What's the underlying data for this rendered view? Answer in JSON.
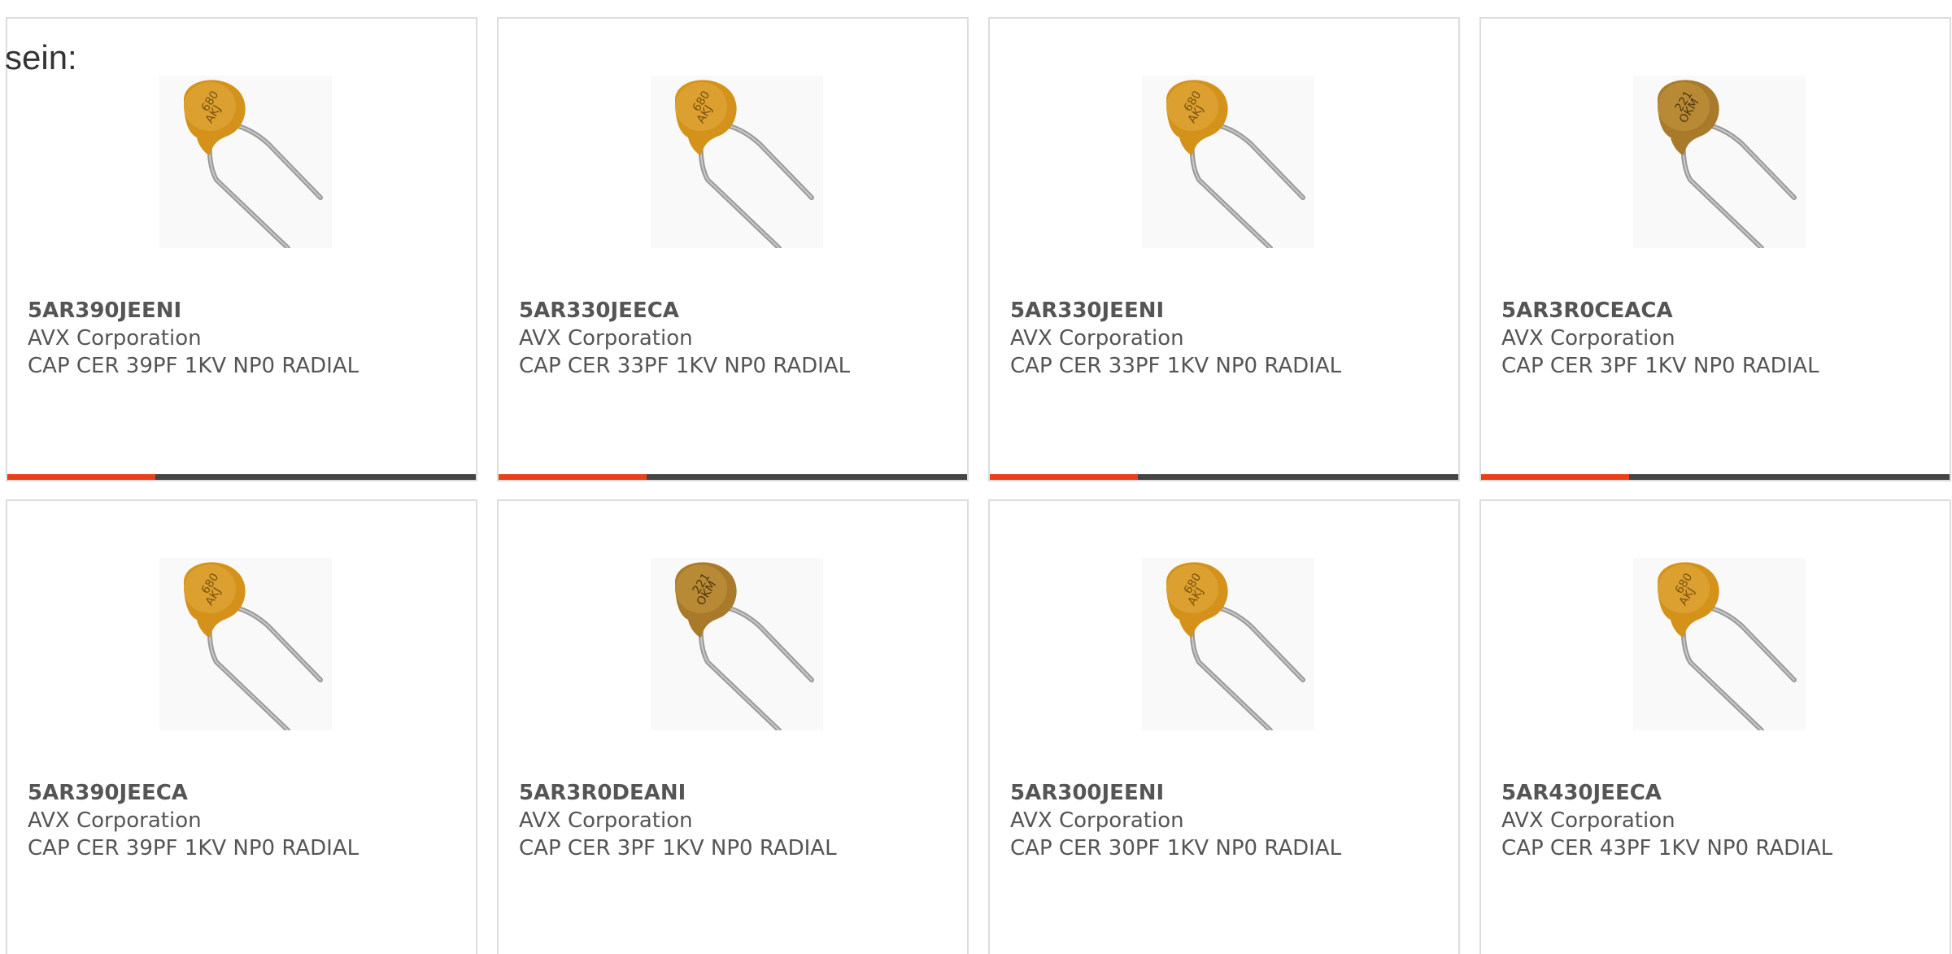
{
  "intro_text": "sein:",
  "colors": {
    "accent": "#e8401c",
    "bar": "#444444",
    "card_border": "#dddddd",
    "text": "#555555",
    "capacitor_body_a": "#d4921a",
    "capacitor_body_b": "#a87a2a"
  },
  "products": [
    {
      "part_number": "5AR390JEENI",
      "manufacturer": "AVX Corporation",
      "description": "CAP CER 39PF 1KV NP0 RADIAL",
      "image_icon": "ceramic-capacitor-icon"
    },
    {
      "part_number": "5AR330JEECA",
      "manufacturer": "AVX Corporation",
      "description": "CAP CER 33PF 1KV NP0 RADIAL",
      "image_icon": "ceramic-capacitor-icon"
    },
    {
      "part_number": "5AR330JEENI",
      "manufacturer": "AVX Corporation",
      "description": "CAP CER 33PF 1KV NP0 RADIAL",
      "image_icon": "ceramic-capacitor-icon"
    },
    {
      "part_number": "5AR3R0CEACA",
      "manufacturer": "AVX Corporation",
      "description": "CAP CER 3PF 1KV NP0 RADIAL",
      "image_icon": "ceramic-capacitor-icon"
    },
    {
      "part_number": "5AR390JEECA",
      "manufacturer": "AVX Corporation",
      "description": "CAP CER 39PF 1KV NP0 RADIAL",
      "image_icon": "ceramic-capacitor-icon"
    },
    {
      "part_number": "5AR3R0DEANI",
      "manufacturer": "AVX Corporation",
      "description": "CAP CER 3PF 1KV NP0 RADIAL",
      "image_icon": "ceramic-capacitor-icon"
    },
    {
      "part_number": "5AR300JEENI",
      "manufacturer": "AVX Corporation",
      "description": "CAP CER 30PF 1KV NP0 RADIAL",
      "image_icon": "ceramic-capacitor-icon"
    },
    {
      "part_number": "5AR430JEECA",
      "manufacturer": "AVX Corporation",
      "description": "CAP CER 43PF 1KV NP0 RADIAL",
      "image_icon": "ceramic-capacitor-icon"
    }
  ]
}
